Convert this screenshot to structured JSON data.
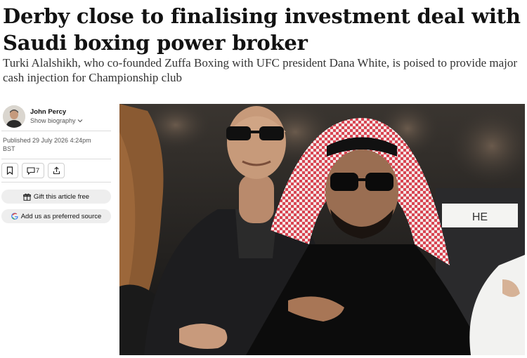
{
  "article": {
    "headline": "Derby close to finalising investment deal with Saudi boxing power broker",
    "standfirst": "Turki Alalshikh, who co-founded Zuffa Boxing with UFC president Dana White, is poised to provide major cash injection for Championship club"
  },
  "byline": {
    "author": "John Percy",
    "show_bio": "Show biography",
    "published_line1": "Published 29 July 2026 4:24pm",
    "published_line2": "BST"
  },
  "actions": {
    "comment_count": "7",
    "gift_label": "Gift this article free",
    "preferred_label": "Add us as preferred source"
  },
  "photo": {
    "seat_label": "HE"
  },
  "icons": [
    "bookmark-icon",
    "comment-icon",
    "share-icon",
    "gift-icon",
    "google-icon",
    "chevron-down-icon"
  ],
  "colors": {
    "text": "#121212",
    "pill_bg": "#eeeeee",
    "keffiyeh_red": "#c8303c"
  }
}
